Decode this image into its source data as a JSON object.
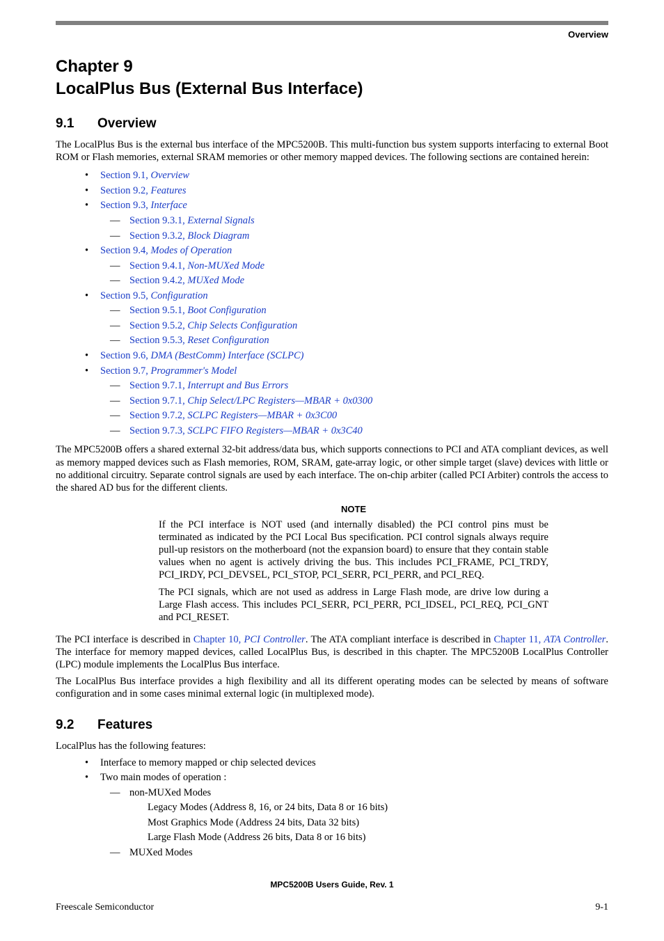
{
  "header": {
    "section_label": "Overview"
  },
  "chapter": {
    "line1": "Chapter 9",
    "line2": "LocalPlus Bus (External Bus Interface)"
  },
  "s91": {
    "num": "9.1",
    "title": "Overview",
    "intro": "The LocalPlus Bus is the external bus interface of the MPC5200B. This multi-function bus system supports interfacing to external Boot ROM or Flash memories, external SRAM memories or other memory mapped devices. The following sections are contained herein:",
    "toc": [
      {
        "lvl": 0,
        "ref": "Section 9.1",
        "title": "Overview"
      },
      {
        "lvl": 0,
        "ref": "Section 9.2",
        "title": "Features"
      },
      {
        "lvl": 0,
        "ref": "Section 9.3",
        "title": "Interface"
      },
      {
        "lvl": 1,
        "ref": "Section 9.3.1",
        "title": "External Signals"
      },
      {
        "lvl": 1,
        "ref": "Section 9.3.2",
        "title": "Block Diagram"
      },
      {
        "lvl": 0,
        "ref": "Section 9.4",
        "title": "Modes of Operation"
      },
      {
        "lvl": 1,
        "ref": "Section 9.4.1",
        "title": "Non-MUXed Mode"
      },
      {
        "lvl": 1,
        "ref": "Section 9.4.2",
        "title": "MUXed Mode"
      },
      {
        "lvl": 0,
        "ref": "Section 9.5",
        "title": "Configuration"
      },
      {
        "lvl": 1,
        "ref": "Section 9.5.1",
        "title": "Boot Configuration"
      },
      {
        "lvl": 1,
        "ref": "Section 9.5.2",
        "title": "Chip Selects Configuration"
      },
      {
        "lvl": 1,
        "ref": "Section 9.5.3",
        "title": "Reset Configuration"
      },
      {
        "lvl": 0,
        "ref": "Section 9.6",
        "title": "DMA (BestComm) Interface (SCLPC)"
      },
      {
        "lvl": 0,
        "ref": "Section 9.7",
        "title": "Programmer's Model"
      },
      {
        "lvl": 1,
        "ref": "Section 9.7.1",
        "title": "Interrupt and Bus Errors"
      },
      {
        "lvl": 1,
        "ref": "Section 9.7.1",
        "title": "Chip Select/LPC Registers—MBAR + 0x0300"
      },
      {
        "lvl": 1,
        "ref": "Section 9.7.2",
        "title": "SCLPC Registers—MBAR + 0x3C00"
      },
      {
        "lvl": 1,
        "ref": "Section 9.7.3",
        "title": "SCLPC FIFO Registers—MBAR + 0x3C40"
      }
    ],
    "para2": "The MPC5200B offers a shared external 32-bit address/data bus, which supports connections to PCI and ATA compliant devices, as well as memory mapped devices such as Flash memories, ROM, SRAM, gate-array logic, or other simple target (slave) devices with little or no additional circuitry. Separate control signals are used by each interface. The on-chip arbiter (called PCI Arbiter) controls the access to the shared AD bus for the different clients.",
    "note_title": "NOTE",
    "note_p1": "If the PCI interface is NOT used (and internally disabled) the PCI control pins must be terminated as indicated by the PCI Local Bus specification. PCI control signals always require pull-up resistors on the motherboard (not the expansion board) to ensure that they contain stable values when no agent is actively driving the bus. This includes PCI_FRAME, PCI_TRDY, PCI_IRDY, PCI_DEVSEL, PCI_STOP, PCI_SERR, PCI_PERR, and PCI_REQ.",
    "note_p2": "The PCI signals, which are not used as address in Large Flash mode, are drive low during a Large Flash access. This includes PCI_SERR, PCI_PERR, PCI_IDSEL, PCI_REQ, PCI_GNT and PCI_RESET.",
    "para3_pre": "The PCI interface is described in ",
    "para3_link1_ref": "Chapter 10",
    "para3_link1_title": "PCI Controller",
    "para3_mid": ". The ATA compliant interface is described in ",
    "para3_link2_ref": "Chapter 11",
    "para3_link2_title": "ATA Controller",
    "para3_post": ". The interface for memory mapped devices, called LocalPlus Bus, is described in this chapter. The MPC5200B LocalPlus Controller (LPC) module implements the LocalPlus Bus interface.",
    "para4": "The LocalPlus Bus interface provides a high flexibility and all its different operating modes can be selected by means of software configuration and in some cases minimal external logic (in multiplexed mode)."
  },
  "s92": {
    "num": "9.2",
    "title": "Features",
    "intro": "LocalPlus has the following features:",
    "items": [
      {
        "lvl": 0,
        "text": "Interface to memory mapped or chip selected devices"
      },
      {
        "lvl": 0,
        "text": "Two main modes of operation :"
      },
      {
        "lvl": 1,
        "text": "non-MUXed Modes"
      },
      {
        "lvl": 2,
        "text": "Legacy Modes (Address 8, 16, or 24 bits, Data 8 or 16 bits)"
      },
      {
        "lvl": 2,
        "text": "Most Graphics Mode (Address 24 bits, Data 32 bits)"
      },
      {
        "lvl": 2,
        "text": "Large Flash Mode (Address 26 bits, Data 8 or 16 bits)"
      },
      {
        "lvl": 1,
        "text": "MUXed Modes"
      }
    ]
  },
  "footer": {
    "docid": "MPC5200B Users Guide, Rev. 1",
    "left": "Freescale Semiconductor",
    "right": "9-1"
  }
}
